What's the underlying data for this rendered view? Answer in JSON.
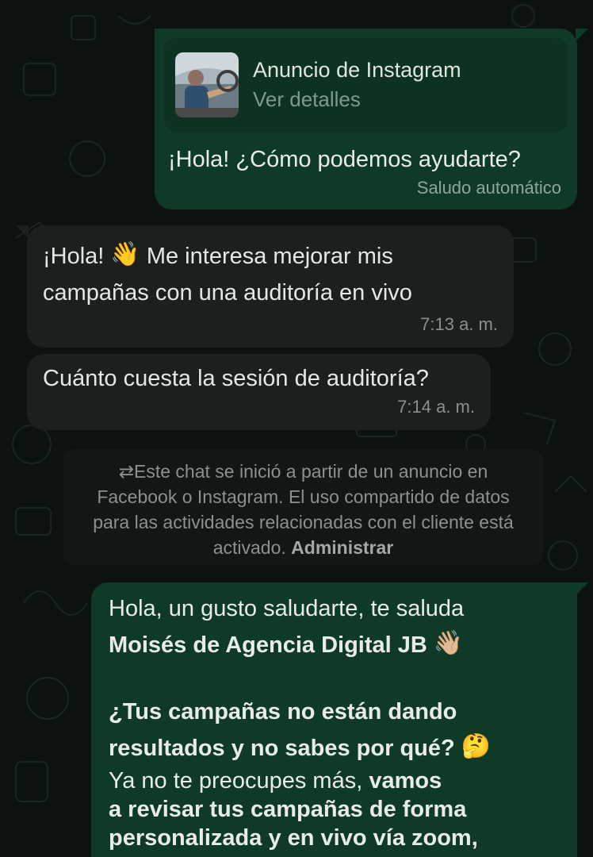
{
  "messages": {
    "ad_message": {
      "card_title": "Anuncio de Instagram",
      "card_subtitle": "Ver detalles",
      "text": "¡Hola! ¿Cómo podemos ayudarte?",
      "tag": "Saludo automático"
    },
    "incoming_1": {
      "text_before_emoji": "¡Hola!",
      "emoji": "👋",
      "text_after_emoji_line1": "Me interesa mejorar mis",
      "text_line2": "campañas con una auditoría en vivo",
      "time": "7:13 a. m."
    },
    "incoming_2": {
      "text": "Cuánto cuesta la sesión de auditoría?",
      "time": "7:14 a. m."
    },
    "notice": {
      "icon": "swap-arrows-icon",
      "text": "Este chat se inició a partir de un anuncio en Facebook o Instagram. El uso compartido de datos para las actividades relacionadas con el cliente está activado.",
      "link": "Administrar"
    },
    "outgoing_reply": {
      "line1": "Hola, un gusto saludarte, te saluda",
      "line2_bold": "Moisés de Agencia Digital JB",
      "line2_emoji": "👋🏼",
      "line3_bold": "¿Tus campañas no están dando",
      "line4_bold": "resultados y no sabes por qué?",
      "line4_emoji": "🤔",
      "line5_regular": "Ya no te preocupes más,",
      "line5_bold": "vamos",
      "line6_bold": "a revisar tus campañas de forma",
      "line7_bold": "personalizada y en vivo vía zoom,"
    }
  },
  "colors": {
    "outgoing_bubble": "#0f3a28",
    "incoming_bubble": "#1b1f1e",
    "background": "#0c1210"
  }
}
